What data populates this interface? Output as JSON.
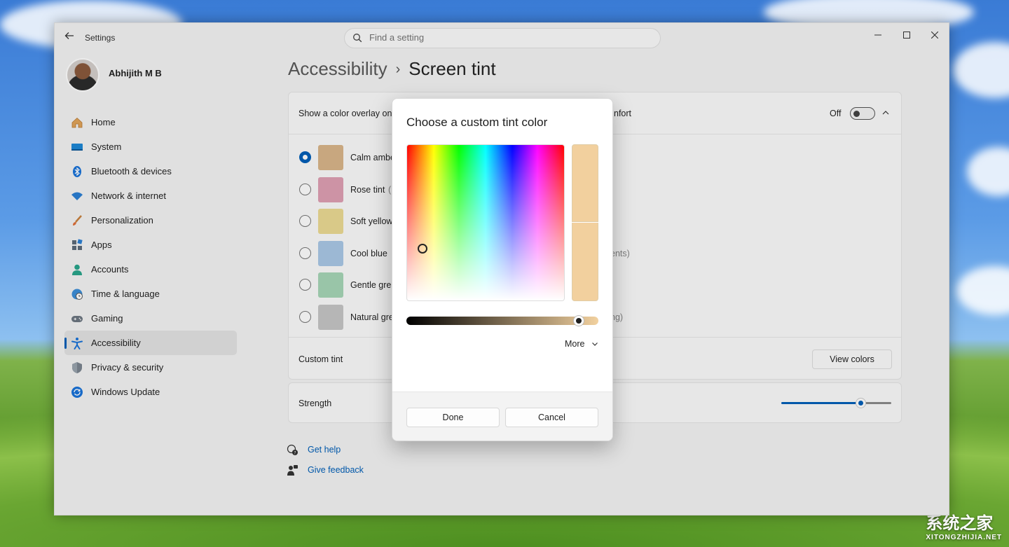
{
  "window": {
    "app_title": "Settings"
  },
  "search": {
    "placeholder": "Find a setting"
  },
  "profile": {
    "name": "Abhijith M B"
  },
  "sidebar": {
    "items": [
      {
        "label": "Home",
        "icon": "home-icon"
      },
      {
        "label": "System",
        "icon": "monitor-icon"
      },
      {
        "label": "Bluetooth & devices",
        "icon": "bluetooth-icon"
      },
      {
        "label": "Network & internet",
        "icon": "wifi-icon"
      },
      {
        "label": "Personalization",
        "icon": "paintbrush-icon"
      },
      {
        "label": "Apps",
        "icon": "apps-icon"
      },
      {
        "label": "Accounts",
        "icon": "person-icon"
      },
      {
        "label": "Time & language",
        "icon": "globe-clock-icon"
      },
      {
        "label": "Gaming",
        "icon": "gamepad-icon"
      },
      {
        "label": "Accessibility",
        "icon": "accessibility-icon",
        "active": true
      },
      {
        "label": "Privacy & security",
        "icon": "shield-icon"
      },
      {
        "label": "Windows Update",
        "icon": "update-icon"
      }
    ]
  },
  "breadcrumb": {
    "parent": "Accessibility",
    "current": "Screen tint"
  },
  "overlay_setting": {
    "label_start": "Show a color overlay on",
    "label_end": "nfort",
    "state": "Off"
  },
  "tints": [
    {
      "label": "Calm ambe",
      "suffix": "",
      "color": "#d9b68a",
      "selected": true
    },
    {
      "label": "Rose tint",
      "suffix": "(",
      "color": "#dfa0b3"
    },
    {
      "label": "Soft yellow",
      "suffix": "",
      "color": "#ecdb94"
    },
    {
      "label": "Cool blue",
      "suffix": "ents)",
      "color": "#aac8e6"
    },
    {
      "label": "Gentle gre",
      "suffix": "",
      "color": "#a7d6b7"
    },
    {
      "label": "Natural gre",
      "suffix": "ng)",
      "color": "#c6c6c6"
    }
  ],
  "custom_tint": {
    "label": "Custom tint",
    "button": "View colors"
  },
  "strength": {
    "label": "Strength",
    "value": 0.72
  },
  "links": {
    "help": "Get help",
    "feedback": "Give feedback"
  },
  "dialog": {
    "title": "Choose a custom tint color",
    "selected_color": "#f2d09e",
    "value_level": 0.92,
    "more": "More",
    "done": "Done",
    "cancel": "Cancel"
  },
  "watermark": {
    "text": "系统之家",
    "sub": "XITONGZHIJIA.NET"
  },
  "colors": {
    "accent": "#005fb8"
  }
}
